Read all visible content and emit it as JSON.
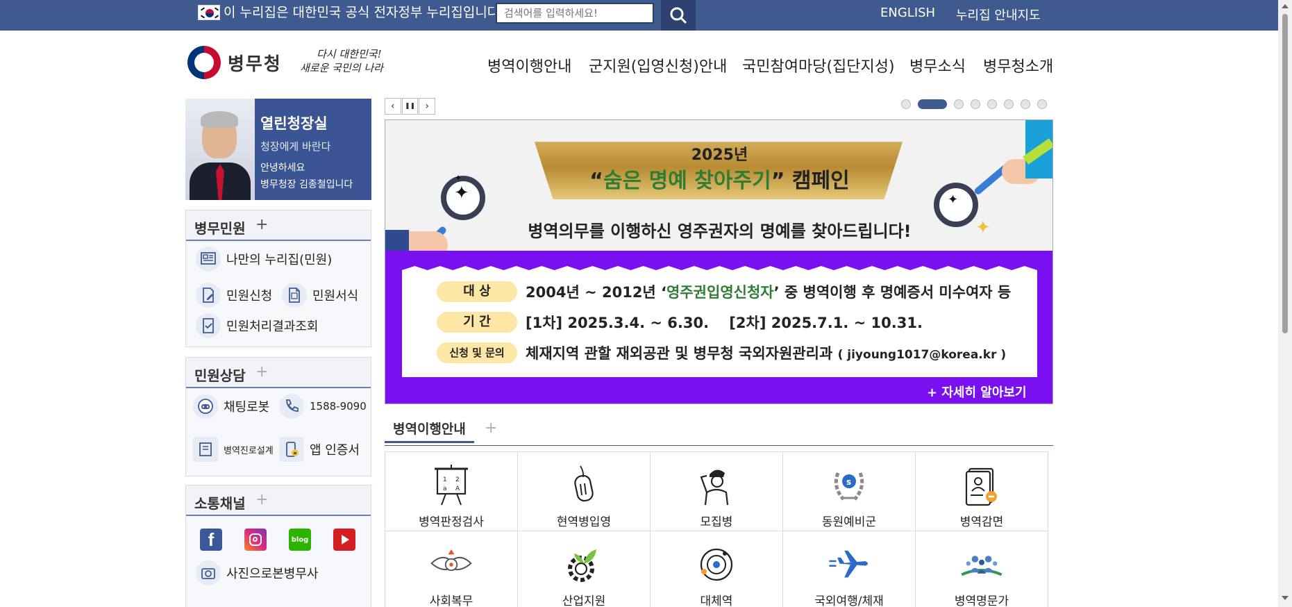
{
  "topbar": {
    "notice": "이 누리집은 대한민국 공식 전자정부 누리집입니다.",
    "search_placeholder": "검색어를 입력하세요!",
    "english": "ENGLISH",
    "sitemap": "누리집 안내지도"
  },
  "header": {
    "logo_text": "병무청",
    "slogan_line1": "다시 대한민국!",
    "slogan_line2": "새로운 국민의 나라",
    "nav": [
      "병역이행안내",
      "군지원(입영신청)안내",
      "국민참여마당(집단지성)",
      "병무소식",
      "병무청소개"
    ]
  },
  "ceo": {
    "title": "열린청장실",
    "sub": "청장에게 바란다",
    "greet1": "안녕하세요",
    "greet2": "병무청장 김종철입니다"
  },
  "civil": {
    "title": "병무민원",
    "plus": "+",
    "items": [
      "나만의 누리집(민원)",
      "민원신청",
      "민원서식",
      "민원처리결과조회"
    ]
  },
  "consult": {
    "title": "민원상담",
    "plus": "+",
    "items": [
      "채팅로봇",
      "1588-9090",
      "병역진로설계",
      "앱 인증서"
    ]
  },
  "channel": {
    "title": "소통채널",
    "plus": "+",
    "sns": [
      "f",
      "ig",
      "blog",
      "yt"
    ],
    "photo": "사진으로본병무사"
  },
  "slider": {
    "prev": "‹",
    "pause": "❚❚",
    "next": "›",
    "dot_count": 8,
    "active_index": 1
  },
  "banner": {
    "year": "2025년",
    "title_open": "“",
    "title_green": "숨은 명예 찾아주기",
    "title_close": "” 캠페인",
    "subtitle": "병역의무를 이행하신 영주권자의 명예를 찾아드립니다!",
    "rows": [
      {
        "label": "대 상",
        "text_a": "2004년 ~ 2012년 ‘",
        "text_green": "영주권입영신청자",
        "text_b": "’ 중 병역이행 후 명예증서 미수여자 등"
      },
      {
        "label": "기 간",
        "text_a": "[1차] 2025.3.4. ~ 6.30.    [2차] 2025.7.1. ~ 10.31.",
        "text_green": "",
        "text_b": ""
      },
      {
        "label": "신청 및 문의",
        "text_a": "체재지역 관할 재외공관 및 병무청 국외자원관리과 ",
        "text_green": "",
        "text_b": "( jiyoung1017@korea.kr )"
      }
    ],
    "more": "+ 자세히 알아보기"
  },
  "guide": {
    "tab": "병역이행안내",
    "plus": "+",
    "items": [
      "병역판정검사",
      "현역병입영",
      "모집병",
      "동원예비군",
      "병역감면",
      "사회복무",
      "산업지원",
      "대체역",
      "국외여행/체재",
      "병역명문가"
    ]
  },
  "colors": {
    "topbar": "#3f5a8f",
    "banner_purple": "#7a0ff0",
    "accent_green": "#2e7d32"
  }
}
